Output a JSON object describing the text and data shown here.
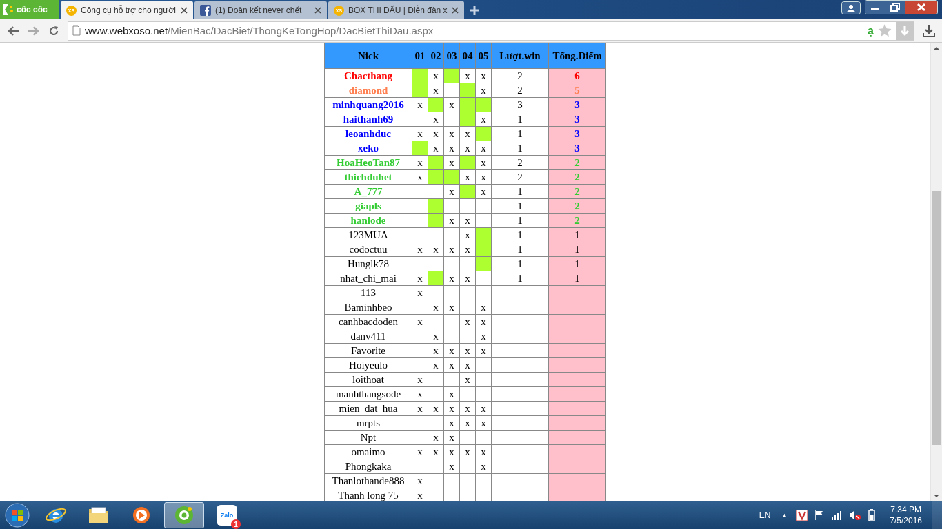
{
  "browser": {
    "brand": "cốc cốc",
    "tabs": [
      {
        "kind": "xs",
        "icon_text": "XS",
        "title": "Công cụ hỗ trợ cho người",
        "selected": true
      },
      {
        "kind": "facebook",
        "title": "(1) Đoàn kết never chết",
        "selected": false
      },
      {
        "kind": "xs",
        "icon_text": "XS",
        "title": "BOX THI ĐẤU | Diễn đàn x",
        "selected": false
      }
    ],
    "url_host": "www.webxoso.net",
    "url_path": "/MienBac/DacBiet/ThongKeTongHop/DacBietThiDau.aspx",
    "input_mark": "ạ"
  },
  "table": {
    "columns": [
      "Nick",
      "01",
      "02",
      "03",
      "04",
      "05",
      "Lượt.win",
      "Tổng.Điểm"
    ],
    "rows": [
      {
        "color": "#ff0000",
        "cells": [
          "Chacthang",
          {
            "hit": true
          },
          {
            "hit": false,
            "text": "x"
          },
          {
            "hit": true
          },
          {
            "hit": false,
            "text": "x"
          },
          {
            "hit": false,
            "text": "x"
          },
          "2",
          "6"
        ]
      },
      {
        "color": "#ff7f50",
        "cells": [
          "diamond",
          {
            "hit": true
          },
          {
            "hit": false,
            "text": "x"
          },
          {
            "hit": false
          },
          {
            "hit": true
          },
          {
            "hit": false,
            "text": "x"
          },
          "2",
          "5"
        ]
      },
      {
        "color": "#0000ff",
        "cells": [
          "minhquang2016",
          {
            "hit": false,
            "text": "x"
          },
          {
            "hit": true
          },
          {
            "hit": false,
            "text": "x"
          },
          {
            "hit": true
          },
          {
            "hit": true
          },
          "3",
          "3"
        ]
      },
      {
        "color": "#0000ff",
        "cells": [
          "haithanh69",
          {
            "hit": false
          },
          {
            "hit": false,
            "text": "x"
          },
          {
            "hit": false
          },
          {
            "hit": true
          },
          {
            "hit": false,
            "text": "x"
          },
          "1",
          "3"
        ]
      },
      {
        "color": "#0000ff",
        "cells": [
          "leoanhduc",
          {
            "hit": false,
            "text": "x"
          },
          {
            "hit": false,
            "text": "x"
          },
          {
            "hit": false,
            "text": "x"
          },
          {
            "hit": false,
            "text": "x"
          },
          {
            "hit": true
          },
          "1",
          "3"
        ]
      },
      {
        "color": "#0000ff",
        "cells": [
          "xeko",
          {
            "hit": true
          },
          {
            "hit": false,
            "text": "x"
          },
          {
            "hit": false,
            "text": "x"
          },
          {
            "hit": false,
            "text": "x"
          },
          {
            "hit": false,
            "text": "x"
          },
          "1",
          "3"
        ]
      },
      {
        "color": "#33cc33",
        "cells": [
          "HoaHeoTan87",
          {
            "hit": false,
            "text": "x"
          },
          {
            "hit": true
          },
          {
            "hit": false,
            "text": "x"
          },
          {
            "hit": true
          },
          {
            "hit": false,
            "text": "x"
          },
          "2",
          "2"
        ]
      },
      {
        "color": "#33cc33",
        "cells": [
          "thichduhet",
          {
            "hit": false,
            "text": "x"
          },
          {
            "hit": true
          },
          {
            "hit": true
          },
          {
            "hit": false,
            "text": "x"
          },
          {
            "hit": false,
            "text": "x"
          },
          "2",
          "2"
        ]
      },
      {
        "color": "#33cc33",
        "cells": [
          "A_777",
          {
            "hit": false
          },
          {
            "hit": false
          },
          {
            "hit": false,
            "text": "x"
          },
          {
            "hit": true
          },
          {
            "hit": false,
            "text": "x"
          },
          "1",
          "2"
        ]
      },
      {
        "color": "#33cc33",
        "cells": [
          "giapls",
          {
            "hit": false
          },
          {
            "hit": true
          },
          {
            "hit": false
          },
          {
            "hit": false
          },
          {
            "hit": false
          },
          "1",
          "2"
        ]
      },
      {
        "color": "#33cc33",
        "cells": [
          "hanlode",
          {
            "hit": false
          },
          {
            "hit": true
          },
          {
            "hit": false,
            "text": "x"
          },
          {
            "hit": false,
            "text": "x"
          },
          {
            "hit": false
          },
          "1",
          "2"
        ]
      },
      {
        "cells": [
          "123MUA",
          {
            "hit": false
          },
          {
            "hit": false
          },
          {
            "hit": false
          },
          {
            "hit": false,
            "text": "x"
          },
          {
            "hit": true
          },
          "1",
          "1"
        ]
      },
      {
        "cells": [
          "codoctuu",
          {
            "hit": false,
            "text": "x"
          },
          {
            "hit": false,
            "text": "x"
          },
          {
            "hit": false,
            "text": "x"
          },
          {
            "hit": false,
            "text": "x"
          },
          {
            "hit": true
          },
          "1",
          "1"
        ]
      },
      {
        "cells": [
          "Hunglk78",
          {
            "hit": false
          },
          {
            "hit": false
          },
          {
            "hit": false
          },
          {
            "hit": false
          },
          {
            "hit": true
          },
          "1",
          "1"
        ]
      },
      {
        "cells": [
          "nhat_chi_mai",
          {
            "hit": false,
            "text": "x"
          },
          {
            "hit": true
          },
          {
            "hit": false,
            "text": "x"
          },
          {
            "hit": false,
            "text": "x"
          },
          {
            "hit": false
          },
          "1",
          "1"
        ]
      },
      {
        "cells": [
          "113",
          {
            "hit": false,
            "text": "x"
          },
          {
            "hit": false
          },
          {
            "hit": false
          },
          {
            "hit": false
          },
          {
            "hit": false
          },
          "",
          ""
        ]
      },
      {
        "cells": [
          "Baminhbeo",
          {
            "hit": false
          },
          {
            "hit": false,
            "text": "x"
          },
          {
            "hit": false,
            "text": "x"
          },
          {
            "hit": false
          },
          {
            "hit": false,
            "text": "x"
          },
          "",
          ""
        ]
      },
      {
        "cells": [
          "canhbacdoden",
          {
            "hit": false,
            "text": "x"
          },
          {
            "hit": false
          },
          {
            "hit": false
          },
          {
            "hit": false,
            "text": "x"
          },
          {
            "hit": false,
            "text": "x"
          },
          "",
          ""
        ]
      },
      {
        "cells": [
          "danv411",
          {
            "hit": false
          },
          {
            "hit": false,
            "text": "x"
          },
          {
            "hit": false
          },
          {
            "hit": false
          },
          {
            "hit": false,
            "text": "x"
          },
          "",
          ""
        ]
      },
      {
        "cells": [
          "Favorite",
          {
            "hit": false
          },
          {
            "hit": false,
            "text": "x"
          },
          {
            "hit": false,
            "text": "x"
          },
          {
            "hit": false,
            "text": "x"
          },
          {
            "hit": false,
            "text": "x"
          },
          "",
          ""
        ]
      },
      {
        "cells": [
          "Hoiyeulo",
          {
            "hit": false
          },
          {
            "hit": false,
            "text": "x"
          },
          {
            "hit": false,
            "text": "x"
          },
          {
            "hit": false,
            "text": "x"
          },
          {
            "hit": false
          },
          "",
          ""
        ]
      },
      {
        "cells": [
          "loithoat",
          {
            "hit": false,
            "text": "x"
          },
          {
            "hit": false
          },
          {
            "hit": false
          },
          {
            "hit": false,
            "text": "x"
          },
          {
            "hit": false
          },
          "",
          ""
        ]
      },
      {
        "cells": [
          "manhthangsode",
          {
            "hit": false,
            "text": "x"
          },
          {
            "hit": false
          },
          {
            "hit": false,
            "text": "x"
          },
          {
            "hit": false
          },
          {
            "hit": false
          },
          "",
          ""
        ]
      },
      {
        "cells": [
          "mien_dat_hua",
          {
            "hit": false,
            "text": "x"
          },
          {
            "hit": false,
            "text": "x"
          },
          {
            "hit": false,
            "text": "x"
          },
          {
            "hit": false,
            "text": "x"
          },
          {
            "hit": false,
            "text": "x"
          },
          "",
          ""
        ]
      },
      {
        "cells": [
          "mrpts",
          {
            "hit": false
          },
          {
            "hit": false
          },
          {
            "hit": false,
            "text": "x"
          },
          {
            "hit": false,
            "text": "x"
          },
          {
            "hit": false,
            "text": "x"
          },
          "",
          ""
        ]
      },
      {
        "cells": [
          "Npt",
          {
            "hit": false
          },
          {
            "hit": false,
            "text": "x"
          },
          {
            "hit": false,
            "text": "x"
          },
          {
            "hit": false
          },
          {
            "hit": false
          },
          "",
          ""
        ]
      },
      {
        "cells": [
          "omaimo",
          {
            "hit": false,
            "text": "x"
          },
          {
            "hit": false,
            "text": "x"
          },
          {
            "hit": false,
            "text": "x"
          },
          {
            "hit": false,
            "text": "x"
          },
          {
            "hit": false,
            "text": "x"
          },
          "",
          ""
        ]
      },
      {
        "cells": [
          "Phongkaka",
          {
            "hit": false
          },
          {
            "hit": false
          },
          {
            "hit": false,
            "text": "x"
          },
          {
            "hit": false
          },
          {
            "hit": false,
            "text": "x"
          },
          "",
          ""
        ]
      },
      {
        "cells": [
          "Thanlothande888",
          {
            "hit": false,
            "text": "x"
          },
          {
            "hit": false
          },
          {
            "hit": false
          },
          {
            "hit": false
          },
          {
            "hit": false
          },
          "",
          ""
        ]
      },
      {
        "cells": [
          "Thanh long 75",
          {
            "hit": false,
            "text": "x"
          },
          {
            "hit": false
          },
          {
            "hit": false
          },
          {
            "hit": false
          },
          {
            "hit": false
          },
          "",
          ""
        ]
      }
    ]
  },
  "taskbar": {
    "apps": [
      {
        "kind": "ie",
        "selected": false
      },
      {
        "kind": "folder",
        "selected": false
      },
      {
        "kind": "media",
        "selected": false
      },
      {
        "kind": "coccoc",
        "selected": true
      },
      {
        "kind": "zalo",
        "label": "Zalo",
        "badge": "1",
        "selected": false
      }
    ],
    "language": "EN",
    "tray_arrow": "▲",
    "time": "7:34 PM",
    "date": "7/5/2016"
  }
}
